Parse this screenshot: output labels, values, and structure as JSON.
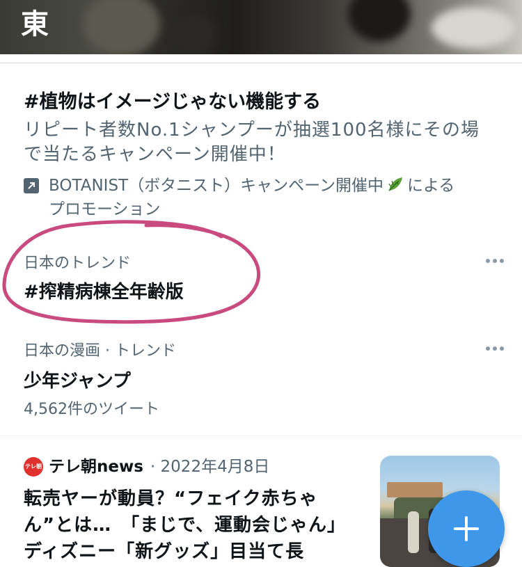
{
  "hero": {
    "title": "東"
  },
  "promo": {
    "title": "#植物はイメージじゃない機能する",
    "description": "リピート者数No.1シャンプーが抽選100名様にその場で当たるキャンペーン開催中！",
    "advertiser_prefix": "BOTANIST（ボタニスト）キャンペーン開催中",
    "advertiser_suffix": "による",
    "promotion_label": "プロモーション"
  },
  "trends": [
    {
      "meta": "日本のトレンド",
      "name": "#搾精病棟全年齢版",
      "count": ""
    },
    {
      "meta": "日本の漫画 · トレンド",
      "name": "少年ジャンプ",
      "count": "4,562件のツイート"
    }
  ],
  "news": {
    "logo_text": "テレ朝",
    "source": "テレ朝news",
    "date": "· 2022年4月8日",
    "headline": "転売ヤーが動員？“フェイク赤ちゃん”とは…　「まじで、運動会じゃん」ディズニー「新グッズ」目当て長"
  },
  "colors": {
    "accent": "#3e97e8",
    "annotation": "#c84a7e",
    "secondary_text": "#536471"
  },
  "icons": {
    "promoted": "promoted-arrow-icon",
    "leaf": "leaf-icon",
    "more": "more-dots-icon",
    "compose": "plus-icon"
  }
}
